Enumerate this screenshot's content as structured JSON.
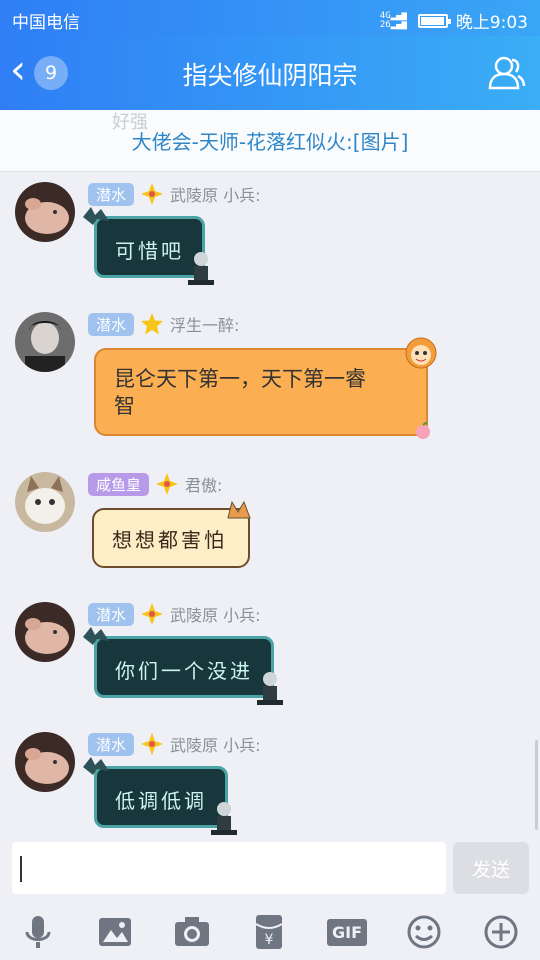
{
  "status_bar": {
    "carrier": "中国电信",
    "network": "4G 46",
    "time": "晚上9:03",
    "battery_level": 0.9
  },
  "header": {
    "title": "指尖修仙阴阳宗",
    "unread_count": "9"
  },
  "notice": {
    "ghost_text": "好强",
    "text": "大佬会-天师-花落红似火:[图片]"
  },
  "messages": [
    {
      "tag": "潜水",
      "badge_color": "#f5c518",
      "sender": "武陵原 小兵:",
      "text": "可惜吧",
      "style": "dark"
    },
    {
      "tag": "潜水",
      "badge_color": "#f5c518",
      "sender": "浮生一醉:",
      "text_line1": "昆仑天下第一，天下第一睿",
      "text_line2": "智",
      "style": "orange"
    },
    {
      "tag": "咸鱼皇",
      "badge_color": "#f5c518",
      "sender": "君傲:",
      "text": "想想都害怕",
      "style": "cream"
    },
    {
      "tag": "潜水",
      "badge_color": "#f5c518",
      "sender": "武陵原 小兵:",
      "text": "你们一个没进",
      "style": "dark"
    },
    {
      "tag": "潜水",
      "badge_color": "#f5c518",
      "sender": "武陵原 小兵:",
      "text": "低调低调",
      "style": "dark"
    }
  ],
  "input": {
    "placeholder": "",
    "send_label": "发送"
  },
  "toolbar": {
    "gif_label": "GIF",
    "icons": [
      "microphone-icon",
      "image-icon",
      "camera-icon",
      "red-packet-icon",
      "gif-icon",
      "emoji-icon",
      "plus-icon"
    ]
  }
}
